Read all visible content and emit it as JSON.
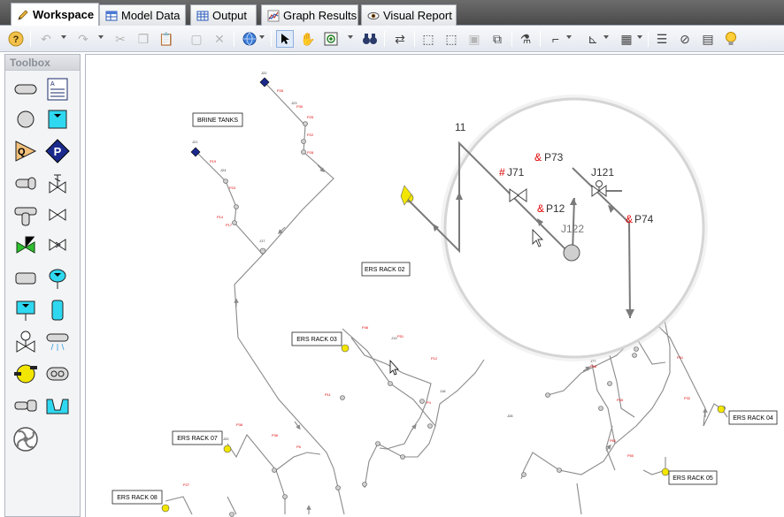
{
  "tabs": [
    {
      "label": "Workspace",
      "icon": "pencil-icon"
    },
    {
      "label": "Model Data",
      "icon": "table-icon"
    },
    {
      "label": "Output",
      "icon": "grid-icon"
    },
    {
      "label": "Graph Results",
      "icon": "chart-icon"
    },
    {
      "label": "Visual Report",
      "icon": "eye-icon"
    }
  ],
  "toolbox": {
    "title": "Toolbox"
  },
  "canvas": {
    "annotations": [
      "BRINE TANKS",
      "ERS RACK 02",
      "ERS RACK 03",
      "ERS RACK 04",
      "ERS RACK 05",
      "ERS RACK 07",
      "ERS RACK 08"
    ],
    "zoom_labels": {
      "j11": "11",
      "p73_prefix": "&",
      "p73": "P73",
      "j71_prefix": "#",
      "j71": "J71",
      "j121": "J121",
      "p12_prefix": "&",
      "p12": "P12",
      "p74_prefix": "&",
      "p74": "P74",
      "j122": "J122"
    }
  },
  "colors": {
    "pipe": "#8a8a8a",
    "zoom_pipe": "#7a7a7a",
    "junction": "#cfcfcf",
    "label_red": "#e00000",
    "tank_blue": "#1a2a8c",
    "reservoir_yellow": "#f2e600",
    "tab_active_bg": "#ffffff"
  }
}
